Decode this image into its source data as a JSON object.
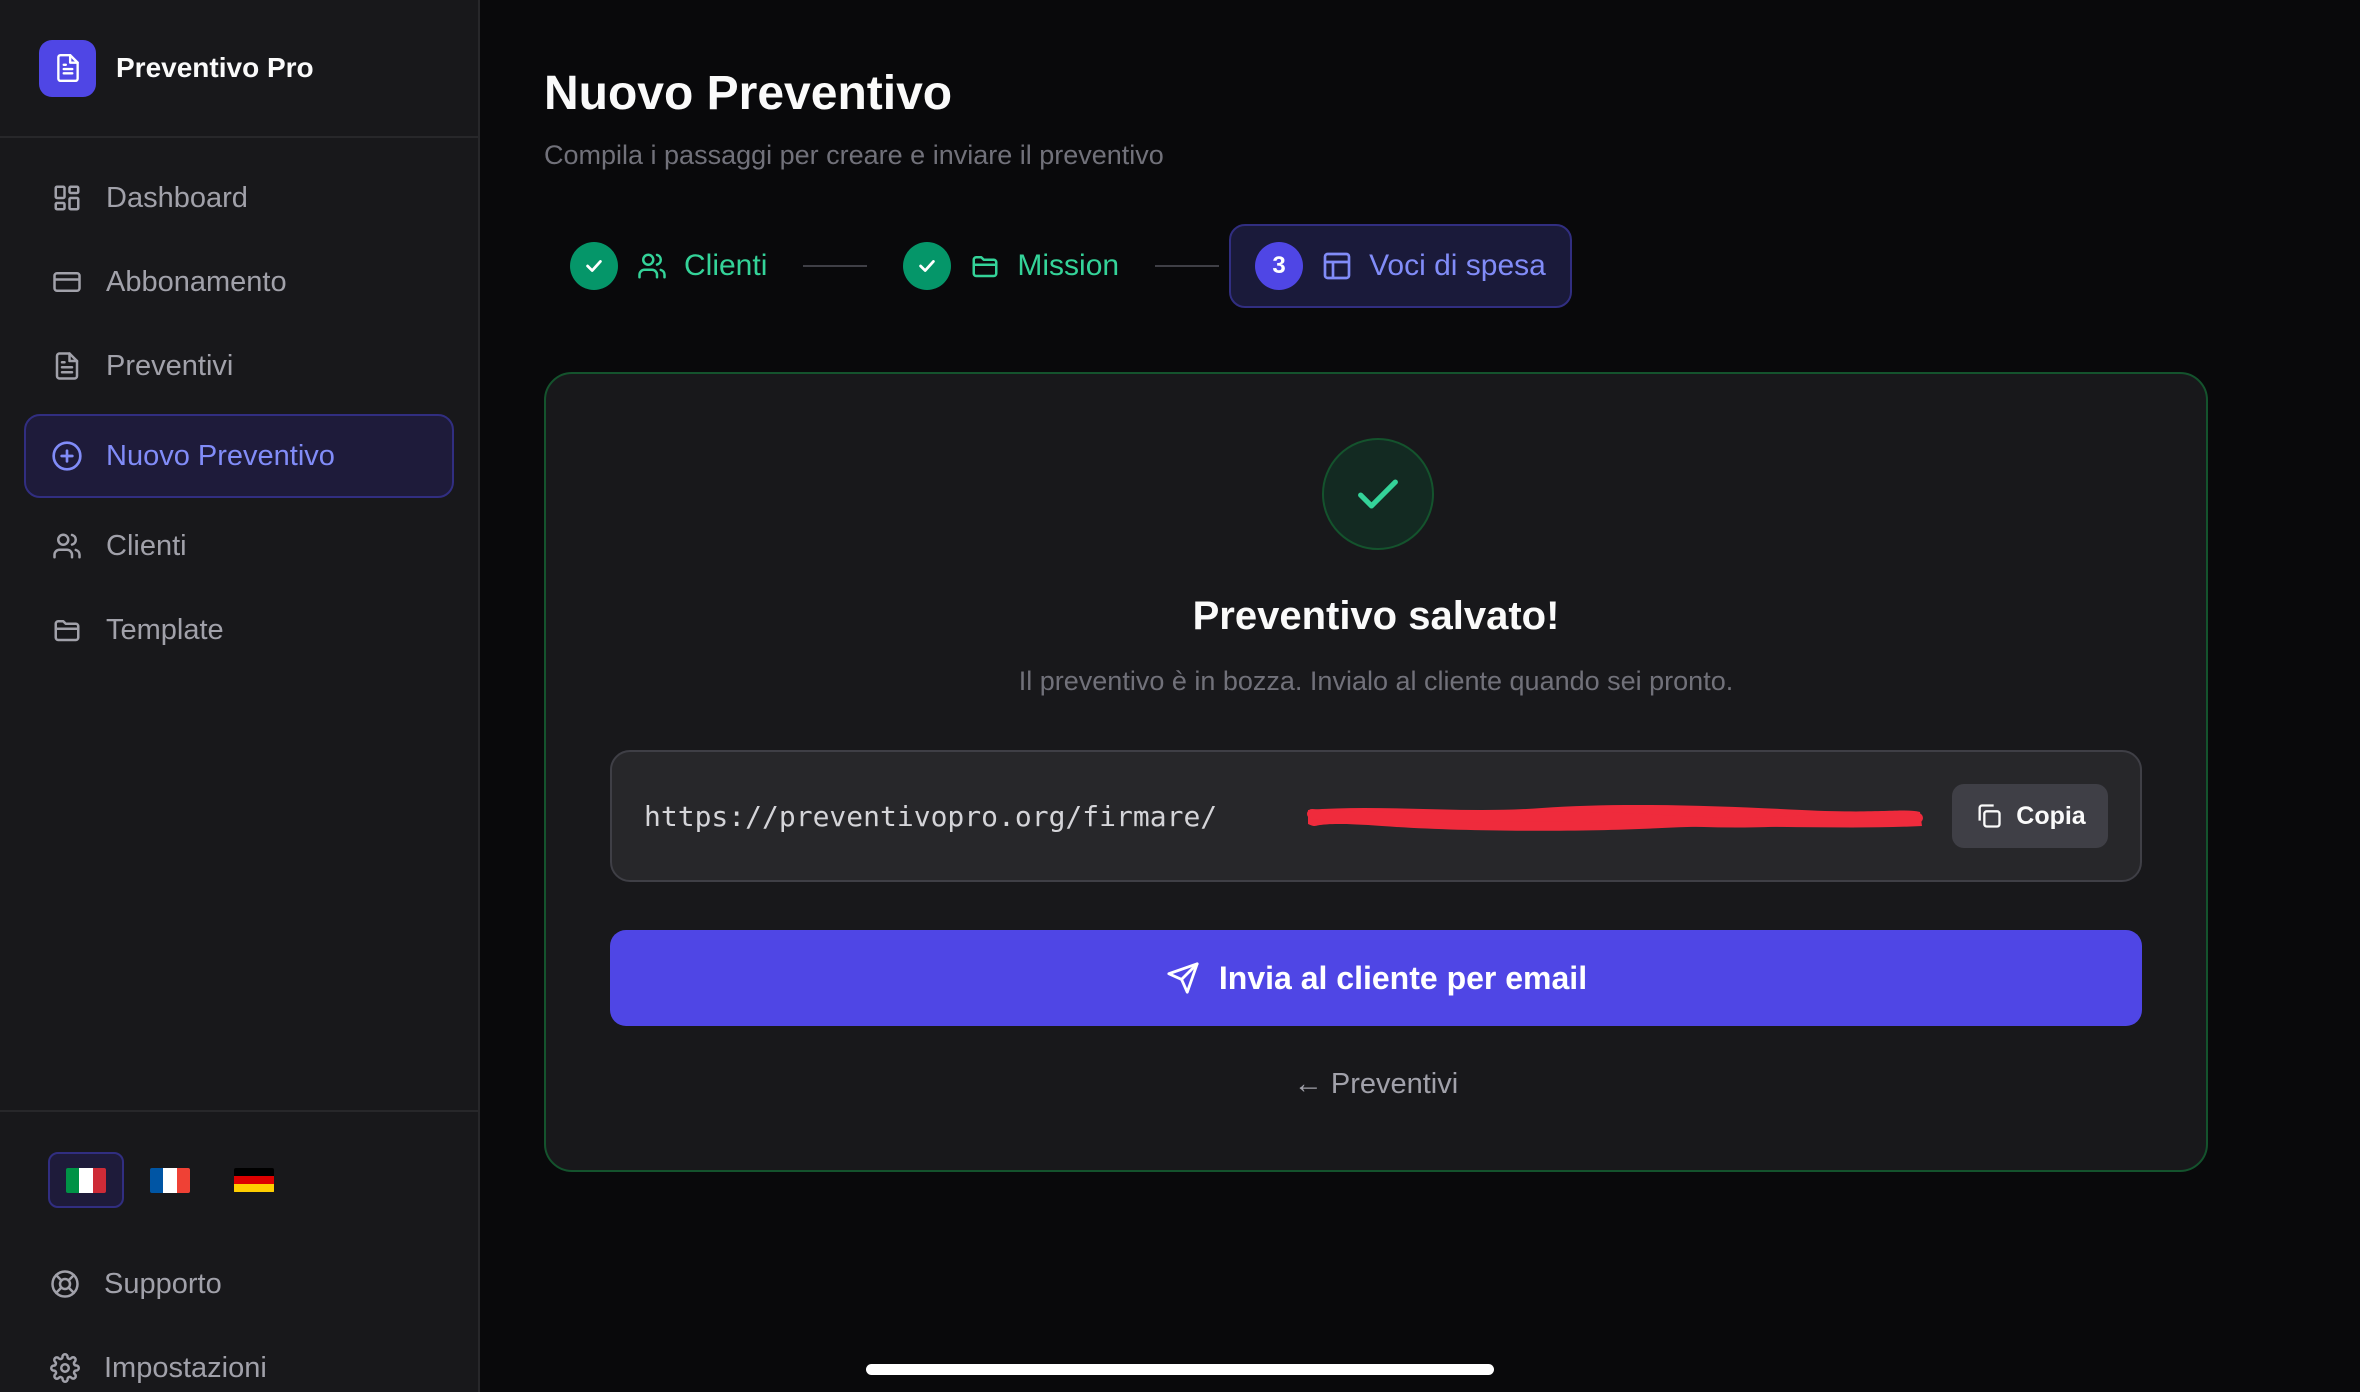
{
  "brand": {
    "name": "Preventivo Pro"
  },
  "sidebar": {
    "items": [
      {
        "label": "Dashboard",
        "icon": "dashboard-icon"
      },
      {
        "label": "Abbonamento",
        "icon": "credit-card-icon"
      },
      {
        "label": "Preventivi",
        "icon": "document-icon"
      },
      {
        "label": "Nuovo Preventivo",
        "icon": "plus-circle-icon",
        "active": true
      },
      {
        "label": "Clienti",
        "icon": "users-icon"
      },
      {
        "label": "Template",
        "icon": "folder-icon"
      }
    ],
    "languages": [
      {
        "code": "it",
        "active": true
      },
      {
        "code": "fr"
      },
      {
        "code": "de"
      }
    ],
    "bottom": [
      {
        "label": "Supporto",
        "icon": "lifebuoy-icon"
      },
      {
        "label": "Impostazioni",
        "icon": "gear-icon"
      }
    ]
  },
  "page": {
    "title": "Nuovo Preventivo",
    "subtitle": "Compila i passaggi per creare e inviare il preventivo"
  },
  "stepper": [
    {
      "label": "Clienti",
      "status": "done",
      "icon": "users-icon"
    },
    {
      "label": "Mission",
      "status": "done",
      "icon": "folder-icon"
    },
    {
      "label": "Voci di spesa",
      "status": "current",
      "number": "3",
      "icon": "table-icon"
    }
  ],
  "card": {
    "title": "Preventivo salvato!",
    "description": "Il preventivo è in bozza. Invialo al cliente quando sei pronto.",
    "link": "https://preventivopro.org/firmare/",
    "copy_label": "Copia",
    "send_label": "Invia al cliente per email",
    "back_label": "← Preventivi"
  },
  "colors": {
    "accent": "#4f46e5",
    "accent_text": "#818cf8",
    "success": "#059669",
    "success_text": "#34d399",
    "redaction": "#ef2b3c"
  }
}
